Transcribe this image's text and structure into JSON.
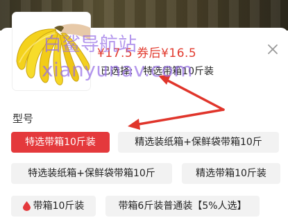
{
  "product": {
    "price": "¥17.5",
    "coupon_price": "券后¥16.5",
    "selected_label": "已选择:",
    "selected_value": "特选带箱10斤装"
  },
  "section": {
    "label": "型号"
  },
  "options": [
    {
      "label": "特选带箱10斤装",
      "active": true
    },
    {
      "label": "精选装纸箱+保鲜袋带箱10斤",
      "active": false
    },
    {
      "label": "特选装纸箱+保鲜袋带箱10斤",
      "active": false
    },
    {
      "label": "精选带箱10斤装",
      "active": false
    },
    {
      "label": "带箱10斤装",
      "active": false,
      "icon": "red-drop-icon"
    },
    {
      "label": "带箱6斤装普通装【5%人选】",
      "active": false
    }
  ],
  "watermark": {
    "line1": "白鲨导航站",
    "line2": "xianyunav.com"
  },
  "colors": {
    "accent": "#e4393c",
    "price": "#e23a2e",
    "arrow": "#e0352b",
    "chip_bg": "#f2f2f2"
  }
}
